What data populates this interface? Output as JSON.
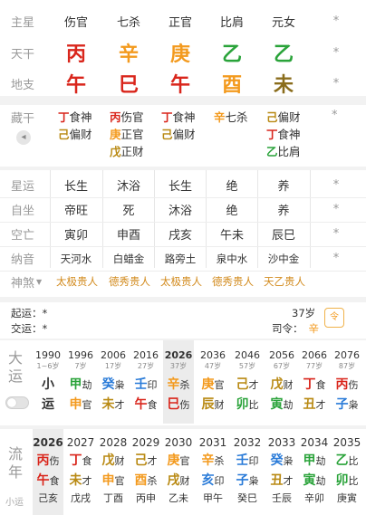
{
  "header": {
    "label": "主星",
    "cols": [
      "伤官",
      "七杀",
      "正官",
      "比肩",
      "元女",
      "*"
    ]
  },
  "tiangan": {
    "label": "天干",
    "chars": [
      "丙",
      "辛",
      "庚",
      "乙",
      "乙"
    ],
    "colors": [
      "#d9261c",
      "#f39a1e",
      "#f39a1e",
      "#2aa33a",
      "#2aa33a"
    ],
    "extra": "*"
  },
  "dizhi": {
    "label": "地支",
    "chars": [
      "午",
      "巳",
      "午",
      "酉",
      "未"
    ],
    "colors": [
      "#d9261c",
      "#d9261c",
      "#d9261c",
      "#f39a1e",
      "#8a6d1c"
    ],
    "extra": "*"
  },
  "canggan": {
    "label": "藏干",
    "cols": [
      [
        {
          "g": "丁",
          "c": "#d9261c",
          "s": "食神"
        },
        {
          "g": "己",
          "c": "#b98a14",
          "s": "偏财"
        }
      ],
      [
        {
          "g": "丙",
          "c": "#d9261c",
          "s": "伤官"
        },
        {
          "g": "庚",
          "c": "#f39a1e",
          "s": "正官"
        },
        {
          "g": "戊",
          "c": "#b98a14",
          "s": "正财"
        }
      ],
      [
        {
          "g": "丁",
          "c": "#d9261c",
          "s": "食神"
        },
        {
          "g": "己",
          "c": "#b98a14",
          "s": "偏财"
        }
      ],
      [
        {
          "g": "辛",
          "c": "#f39a1e",
          "s": "七杀"
        }
      ],
      [
        {
          "g": "己",
          "c": "#b98a14",
          "s": "偏财"
        },
        {
          "g": "丁",
          "c": "#d9261c",
          "s": "食神"
        },
        {
          "g": "乙",
          "c": "#2aa33a",
          "s": "比肩"
        }
      ]
    ],
    "extra": "*"
  },
  "xingyun": {
    "label": "星运",
    "cols": [
      "长生",
      "沐浴",
      "长生",
      "绝",
      "养",
      "*"
    ]
  },
  "zizuo": {
    "label": "自坐",
    "cols": [
      "帝旺",
      "死",
      "沐浴",
      "绝",
      "养",
      "*"
    ]
  },
  "kongwang": {
    "label": "空亡",
    "cols": [
      "寅卯",
      "申酉",
      "戌亥",
      "午未",
      "辰巳",
      "*"
    ]
  },
  "nayin": {
    "label": "纳音",
    "cols": [
      "天河水",
      "白蜡金",
      "路旁土",
      "泉中水",
      "沙中金",
      "*"
    ]
  },
  "shensha": {
    "label": "神煞",
    "items": [
      "太极贵人",
      "德秀贵人",
      "太极贵人",
      "德秀贵人",
      "天乙贵人"
    ]
  },
  "qiyun": {
    "label": "起运：",
    "value": "*",
    "age": "37岁"
  },
  "jiaoyun": {
    "label": "交运：",
    "value": "*",
    "siling_label": "司令：",
    "siling": "辛"
  },
  "dayun": {
    "title": "大运",
    "xiaoyun": "小运",
    "cols": [
      {
        "year": "1990",
        "age": "1~6岁",
        "top": "小",
        "bottom": "运",
        "c1": "#333",
        "c2": "#333",
        "s1": "",
        "s2": ""
      },
      {
        "year": "1996",
        "age": "7岁",
        "top": "甲",
        "bottom": "申",
        "c1": "#2aa33a",
        "c2": "#f39a1e",
        "s1": "劫",
        "s2": "官"
      },
      {
        "year": "2006",
        "age": "17岁",
        "top": "癸",
        "bottom": "未",
        "c1": "#2a7bd8",
        "c2": "#b98a14",
        "s1": "枭",
        "s2": "才"
      },
      {
        "year": "2016",
        "age": "27岁",
        "top": "壬",
        "bottom": "午",
        "c1": "#2a7bd8",
        "c2": "#d9261c",
        "s1": "印",
        "s2": "食"
      },
      {
        "year": "2026",
        "age": "37岁",
        "top": "辛",
        "bottom": "巳",
        "c1": "#f39a1e",
        "c2": "#d9261c",
        "s1": "杀",
        "s2": "伤"
      },
      {
        "year": "2036",
        "age": "47岁",
        "top": "庚",
        "bottom": "辰",
        "c1": "#f39a1e",
        "c2": "#b98a14",
        "s1": "官",
        "s2": "财"
      },
      {
        "year": "2046",
        "age": "57岁",
        "top": "己",
        "bottom": "卯",
        "c1": "#b98a14",
        "c2": "#2aa33a",
        "s1": "才",
        "s2": "比"
      },
      {
        "year": "2056",
        "age": "67岁",
        "top": "戊",
        "bottom": "寅",
        "c1": "#b98a14",
        "c2": "#2aa33a",
        "s1": "财",
        "s2": "劫"
      },
      {
        "year": "2066",
        "age": "77岁",
        "top": "丁",
        "bottom": "丑",
        "c1": "#d9261c",
        "c2": "#b98a14",
        "s1": "食",
        "s2": "才"
      },
      {
        "year": "2076",
        "age": "87岁",
        "top": "丙",
        "bottom": "子",
        "c1": "#d9261c",
        "c2": "#2a7bd8",
        "s1": "伤",
        "s2": "枭"
      }
    ]
  },
  "liunian": {
    "title": "流年",
    "xiaoyun": "小运",
    "cols": [
      {
        "year": "2026",
        "top": "丙",
        "bottom": "午",
        "c1": "#d9261c",
        "c2": "#d9261c",
        "s1": "伤",
        "s2": "食",
        "xy": "己亥"
      },
      {
        "year": "2027",
        "top": "丁",
        "bottom": "未",
        "c1": "#d9261c",
        "c2": "#b98a14",
        "s1": "食",
        "s2": "才",
        "xy": "戊戌"
      },
      {
        "year": "2028",
        "top": "戊",
        "bottom": "申",
        "c1": "#b98a14",
        "c2": "#f39a1e",
        "s1": "财",
        "s2": "官",
        "xy": "丁酉"
      },
      {
        "year": "2029",
        "top": "己",
        "bottom": "酉",
        "c1": "#b98a14",
        "c2": "#f39a1e",
        "s1": "才",
        "s2": "杀",
        "xy": "丙申"
      },
      {
        "year": "2030",
        "top": "庚",
        "bottom": "戌",
        "c1": "#f39a1e",
        "c2": "#b98a14",
        "s1": "官",
        "s2": "财",
        "xy": "乙未"
      },
      {
        "year": "2031",
        "top": "辛",
        "bottom": "亥",
        "c1": "#f39a1e",
        "c2": "#2a7bd8",
        "s1": "杀",
        "s2": "印",
        "xy": "甲午"
      },
      {
        "year": "2032",
        "top": "壬",
        "bottom": "子",
        "c1": "#2a7bd8",
        "c2": "#2a7bd8",
        "s1": "印",
        "s2": "枭",
        "xy": "癸巳"
      },
      {
        "year": "2033",
        "top": "癸",
        "bottom": "丑",
        "c1": "#2a7bd8",
        "c2": "#b98a14",
        "s1": "枭",
        "s2": "才",
        "xy": "壬辰"
      },
      {
        "year": "2034",
        "top": "甲",
        "bottom": "寅",
        "c1": "#2aa33a",
        "c2": "#2aa33a",
        "s1": "劫",
        "s2": "劫",
        "xy": "辛卯"
      },
      {
        "year": "2035",
        "top": "乙",
        "bottom": "卯",
        "c1": "#2aa33a",
        "c2": "#2aa33a",
        "s1": "比",
        "s2": "比",
        "xy": "庚寅"
      }
    ]
  }
}
